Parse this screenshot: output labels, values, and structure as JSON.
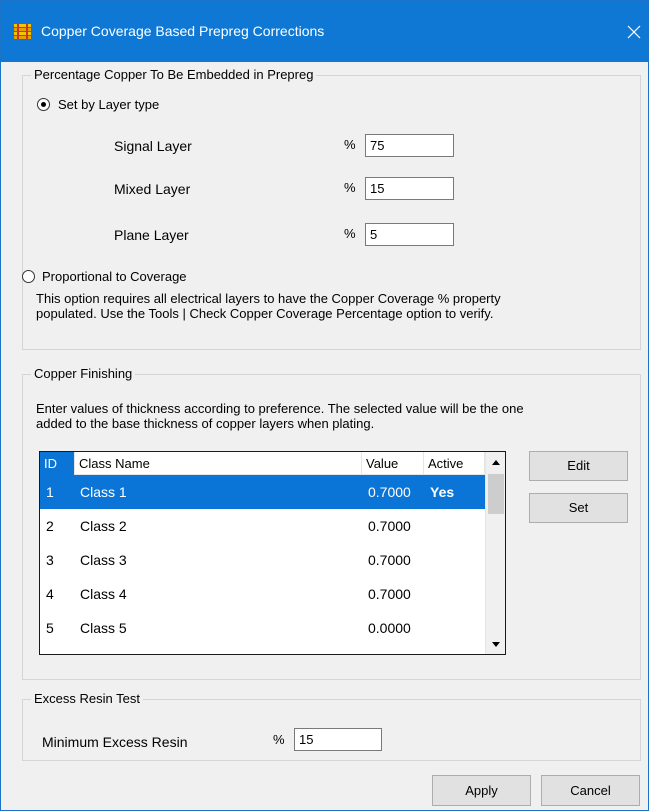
{
  "window": {
    "title": "Copper Coverage Based Prepreg Corrections"
  },
  "prepreg_group": {
    "label": "Percentage Copper To Be Embedded in Prepreg",
    "option_layer_type": {
      "label": "Set by Layer type",
      "selected": true
    },
    "layers": [
      {
        "label": "Signal Layer",
        "unit": "%",
        "value": "75"
      },
      {
        "label": "Mixed Layer",
        "unit": "%",
        "value": "15"
      },
      {
        "label": "Plane Layer",
        "unit": "%",
        "value": "5"
      }
    ],
    "option_proportional": {
      "label": "Proportional to Coverage",
      "selected": false
    },
    "note_line1": "This option requires all electrical layers to have the Copper Coverage %  property",
    "note_line2": "populated.  Use the Tools | Check Copper Coverage Percentage option to verify."
  },
  "finishing_group": {
    "label": "Copper Finishing",
    "description_line1": "Enter values of thickness according to preference. The selected value will be the one",
    "description_line2": "added to the base thickness of copper layers when plating.",
    "columns": {
      "id": "ID",
      "class_name": "Class Name",
      "value": "Value",
      "active": "Active"
    },
    "rows": [
      {
        "id": "1",
        "name": "Class 1",
        "value": "0.7000",
        "active": "Yes",
        "selected": true
      },
      {
        "id": "2",
        "name": "Class 2",
        "value": "0.7000",
        "active": ""
      },
      {
        "id": "3",
        "name": "Class 3",
        "value": "0.7000",
        "active": ""
      },
      {
        "id": "4",
        "name": "Class 4",
        "value": "0.7000",
        "active": ""
      },
      {
        "id": "5",
        "name": "Class 5",
        "value": "0.0000",
        "active": ""
      }
    ],
    "edit_button": "Edit",
    "set_button": "Set"
  },
  "resin_group": {
    "label": "Excess Resin Test",
    "field_label": "Minimum Excess Resin",
    "unit": "%",
    "value": "15"
  },
  "buttons": {
    "apply": "Apply",
    "cancel": "Cancel"
  },
  "colors": {
    "title_bar": "#0e78d4",
    "selection": "#0b75d7",
    "window_bg": "#f0f0f0"
  },
  "icons": {
    "app": "app-stackup-icon",
    "close": "close-icon",
    "scroll_up": "scroll-up-arrow-icon",
    "scroll_down": "scroll-down-arrow-icon"
  }
}
